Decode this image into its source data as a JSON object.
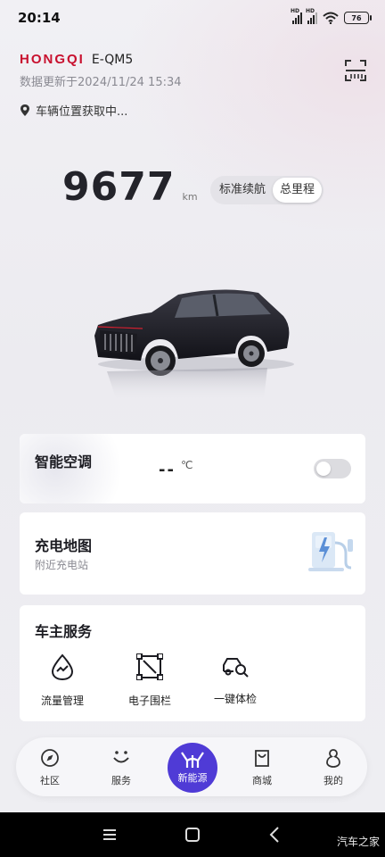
{
  "status_bar": {
    "time": "20:14",
    "battery": "76",
    "signal_label": "HD"
  },
  "header": {
    "brand": "HONGQI",
    "model": "E-QM5",
    "update_time": "数据更新于2024/11/24 15:34",
    "location": "车辆位置获取中..."
  },
  "mileage": {
    "value": "9677",
    "unit": "km",
    "options": [
      "标准续航",
      "总里程"
    ],
    "selected": "总里程"
  },
  "ac_card": {
    "title": "智能空调",
    "temperature": "--",
    "unit": "℃",
    "switch_on": false
  },
  "charge_card": {
    "title": "充电地图",
    "subtitle": "附近充电站"
  },
  "service_card": {
    "title": "车主服务",
    "items": [
      {
        "label": "流量管理",
        "icon": "data-flow-icon"
      },
      {
        "label": "电子围栏",
        "icon": "geofence-icon"
      },
      {
        "label": "一键体检",
        "icon": "car-check-icon"
      }
    ]
  },
  "tab_bar": {
    "items": [
      {
        "label": "社区",
        "icon": "compass-icon"
      },
      {
        "label": "服务",
        "icon": "smile-icon"
      },
      {
        "label": "新能源",
        "icon": "hongqi-logo-icon",
        "active": true
      },
      {
        "label": "商城",
        "icon": "shopping-bag-icon"
      },
      {
        "label": "我的",
        "icon": "profile-icon"
      }
    ],
    "active_color": "#4f3bd6"
  },
  "watermark": "汽车之家"
}
